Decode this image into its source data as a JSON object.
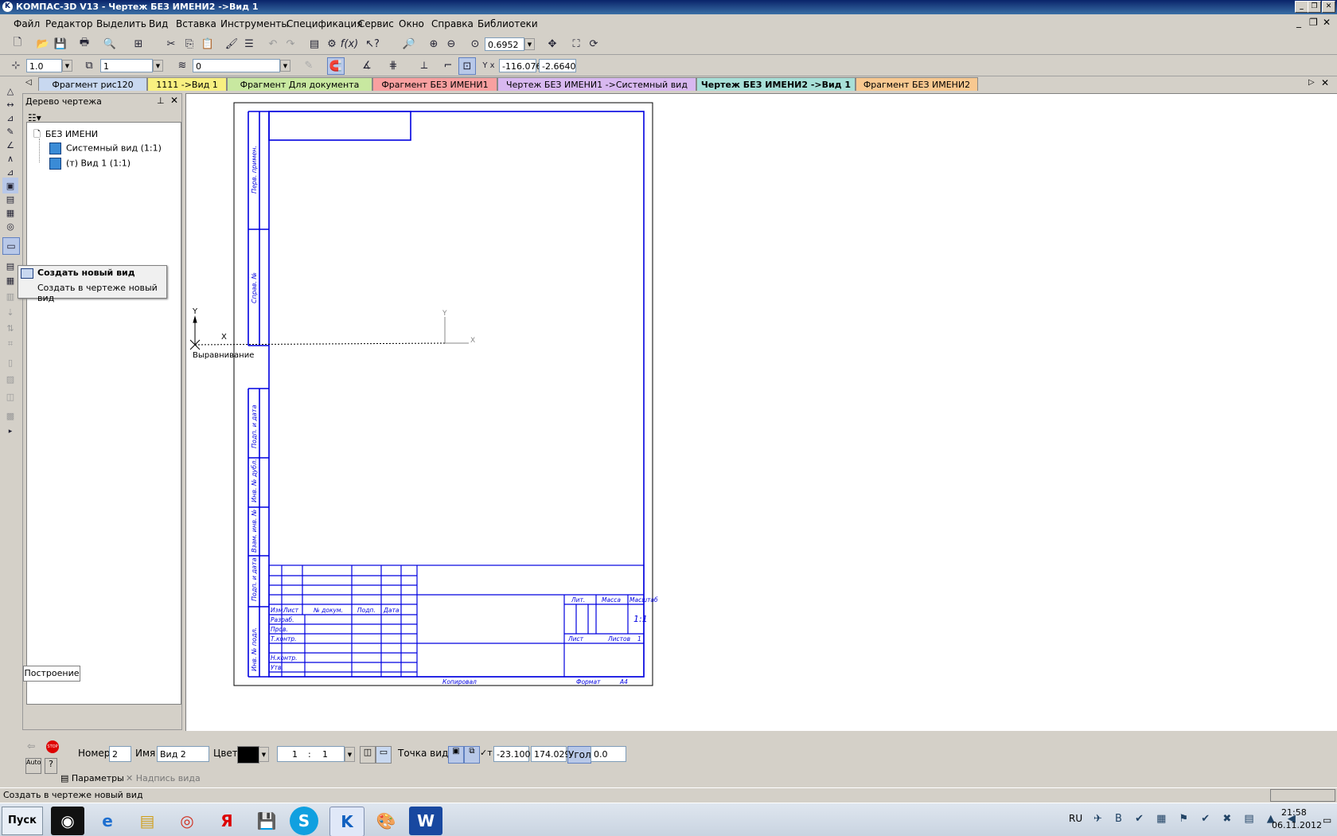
{
  "window": {
    "title": "КОМПАС-3D V13 - Чертеж БЕЗ ИМЕНИ2 ->Вид 1"
  },
  "menu": [
    "Файл",
    "Редактор",
    "Выделить",
    "Вид",
    "Вставка",
    "Инструменты",
    "Спецификация",
    "Сервис",
    "Окно",
    "Справка",
    "Библиотеки"
  ],
  "toolbar": {
    "zoom": "0.6952"
  },
  "toolbar2": {
    "step": "1.0",
    "view": "1",
    "layer": "0",
    "coord_x": "-116.076",
    "coord_y": "-2.6640"
  },
  "tabs": [
    {
      "label": "Фрагмент рис120",
      "color": "#c8d8f0"
    },
    {
      "label": "1111 ->Вид 1",
      "color": "#f8f080"
    },
    {
      "label": "Фрагмент Для документа",
      "color": "#c8e8a0"
    },
    {
      "label": "Фрагмент БЕЗ ИМЕНИ1",
      "color": "#f8a0a0"
    },
    {
      "label": "Чертеж БЕЗ ИМЕНИ1 ->Системный вид",
      "color": "#d8b8f0"
    },
    {
      "label": "Чертеж БЕЗ ИМЕНИ2 ->Вид 1",
      "color": "#a8e0d8"
    },
    {
      "label": "Фрагмент БЕЗ ИМЕНИ2",
      "color": "#f8c890"
    }
  ],
  "tree": {
    "title": "Дерево чертежа",
    "root": "БЕЗ ИМЕНИ",
    "items": [
      "Системный вид (1:1)",
      "(т) Вид 1 (1:1)"
    ],
    "footer_tab": "Построение"
  },
  "tooltip": {
    "title": "Создать новый вид",
    "text": "Создать в чертеже новый вид"
  },
  "drawing": {
    "axis_y": "Y",
    "axis_x": "X",
    "align_label": "Выравнивание",
    "side_labels": [
      "Перв. примен.",
      "Справ. №",
      "Подп. и дата",
      "Инв. № дубл.",
      "Взам. инв. №",
      "Подп. и дата",
      "Инв. № подл."
    ],
    "stamp_cols": [
      "Изм.",
      "Лист",
      "№ докум.",
      "Подп.",
      "Дата"
    ],
    "stamp_rows": [
      "Разраб.",
      "Пров.",
      "Т.контр.",
      "Н.контр.",
      "Утв."
    ],
    "lit": "Лит.",
    "mass": "Масса",
    "scale": "Масштаб",
    "scale_val": "1:1",
    "sheet": "Лист",
    "sheets": "Листов",
    "sheets_val": "1",
    "copied": "Копировал",
    "format": "Формат",
    "format_val": "А4"
  },
  "props": {
    "number_label": "Номер",
    "number": "2",
    "name_label": "Имя",
    "name": "Вид 2",
    "color_label": "Цвет",
    "scale_a": "1",
    "scale_sep": ":",
    "scale_b": "1",
    "point_label": "Точка вида",
    "px": "-23.1003",
    "py": "174.029",
    "angle_label": "Угол",
    "angle": "0.0",
    "tab_params": "Параметры",
    "tab_label": "Надпись вида"
  },
  "status": {
    "text": "Создать в чертеже новый вид"
  },
  "taskbar": {
    "start": "Пуск",
    "lang": "RU",
    "time": "21:58",
    "date": "06.11.2012"
  }
}
